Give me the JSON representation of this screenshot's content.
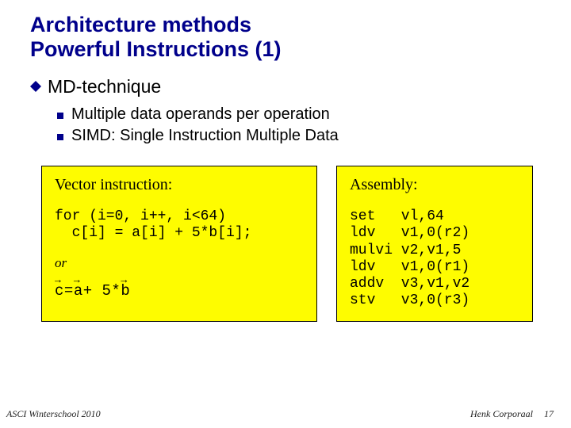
{
  "title_line1": "Architecture methods",
  "title_line2": "Powerful Instructions (1)",
  "bullet1": "MD-technique",
  "sub_bullets": [
    "Multiple data operands per operation",
    "SIMD: Single Instruction Multiple Data"
  ],
  "left_box": {
    "title": "Vector instruction:",
    "code": "for (i=0, i++, i<64)\n  c[i] = a[i] + 5*b[i];",
    "or_label": "or",
    "vec_parts": {
      "c": "c",
      "eq": " = ",
      "a": "a",
      "mid": " + 5*",
      "b": "b"
    }
  },
  "right_box": {
    "title": "Assembly:",
    "code": "set   vl,64\nldv   v1,0(r2)\nmulvi v2,v1,5\nldv   v1,0(r1)\naddv  v3,v1,v2\nstv   v3,0(r3)"
  },
  "footer": {
    "left": "ASCI Winterschool 2010",
    "right_name": "Henk Corporaal",
    "right_page": "17"
  }
}
